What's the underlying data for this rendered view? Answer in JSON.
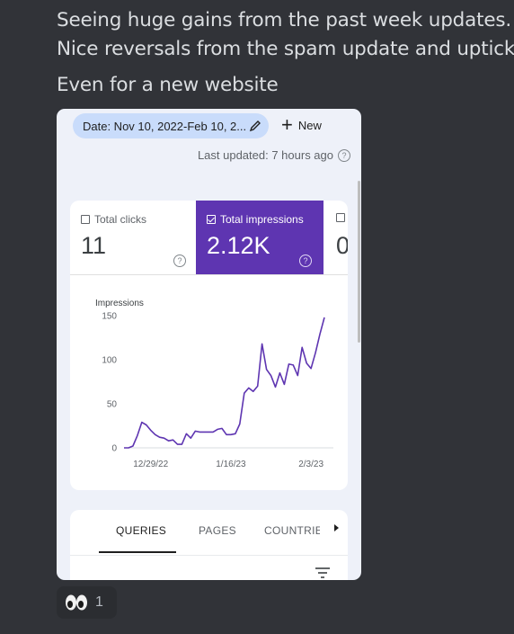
{
  "message": {
    "line1": "Seeing huge gains from the past week updates.",
    "line2": "Nice reversals from the spam update and upticks",
    "line3": "Even for a new website"
  },
  "screenshot": {
    "date_range": "Date: Nov 10, 2022-Feb 10, 2...",
    "new_label": "New",
    "last_updated": "Last updated: 7 hours ago",
    "metrics": {
      "clicks_label": "Total clicks",
      "clicks_value": "11",
      "impressions_label": "Total impressions",
      "impressions_value": "2.12K",
      "third_value": "0"
    },
    "tabs": [
      "QUERIES",
      "PAGES",
      "COUNTRIES"
    ]
  },
  "chart_data": {
    "type": "line",
    "ylabel": "Impressions",
    "yticks": [
      0,
      50,
      100,
      150
    ],
    "ylim": [
      0,
      150
    ],
    "xtick_labels": [
      "12/29/22",
      "1/16/23",
      "2/3/23"
    ],
    "xtick_index": [
      6,
      24,
      42
    ],
    "color": "#5e35b1",
    "values": [
      0,
      0,
      2,
      14,
      29,
      26,
      20,
      15,
      12,
      11,
      8,
      9,
      4,
      4,
      16,
      11,
      19,
      18,
      18,
      18,
      18,
      21,
      22,
      15,
      15,
      16,
      27,
      62,
      68,
      64,
      70,
      118,
      89,
      82,
      69,
      85,
      72,
      95,
      94,
      82,
      114,
      96,
      90,
      108,
      129,
      148
    ]
  },
  "reaction": {
    "emoji": "eyes-emoji",
    "count": "1"
  },
  "colors": {
    "background": "#313338",
    "accent": "#5e35b1",
    "chip": "#c9dcfb"
  }
}
